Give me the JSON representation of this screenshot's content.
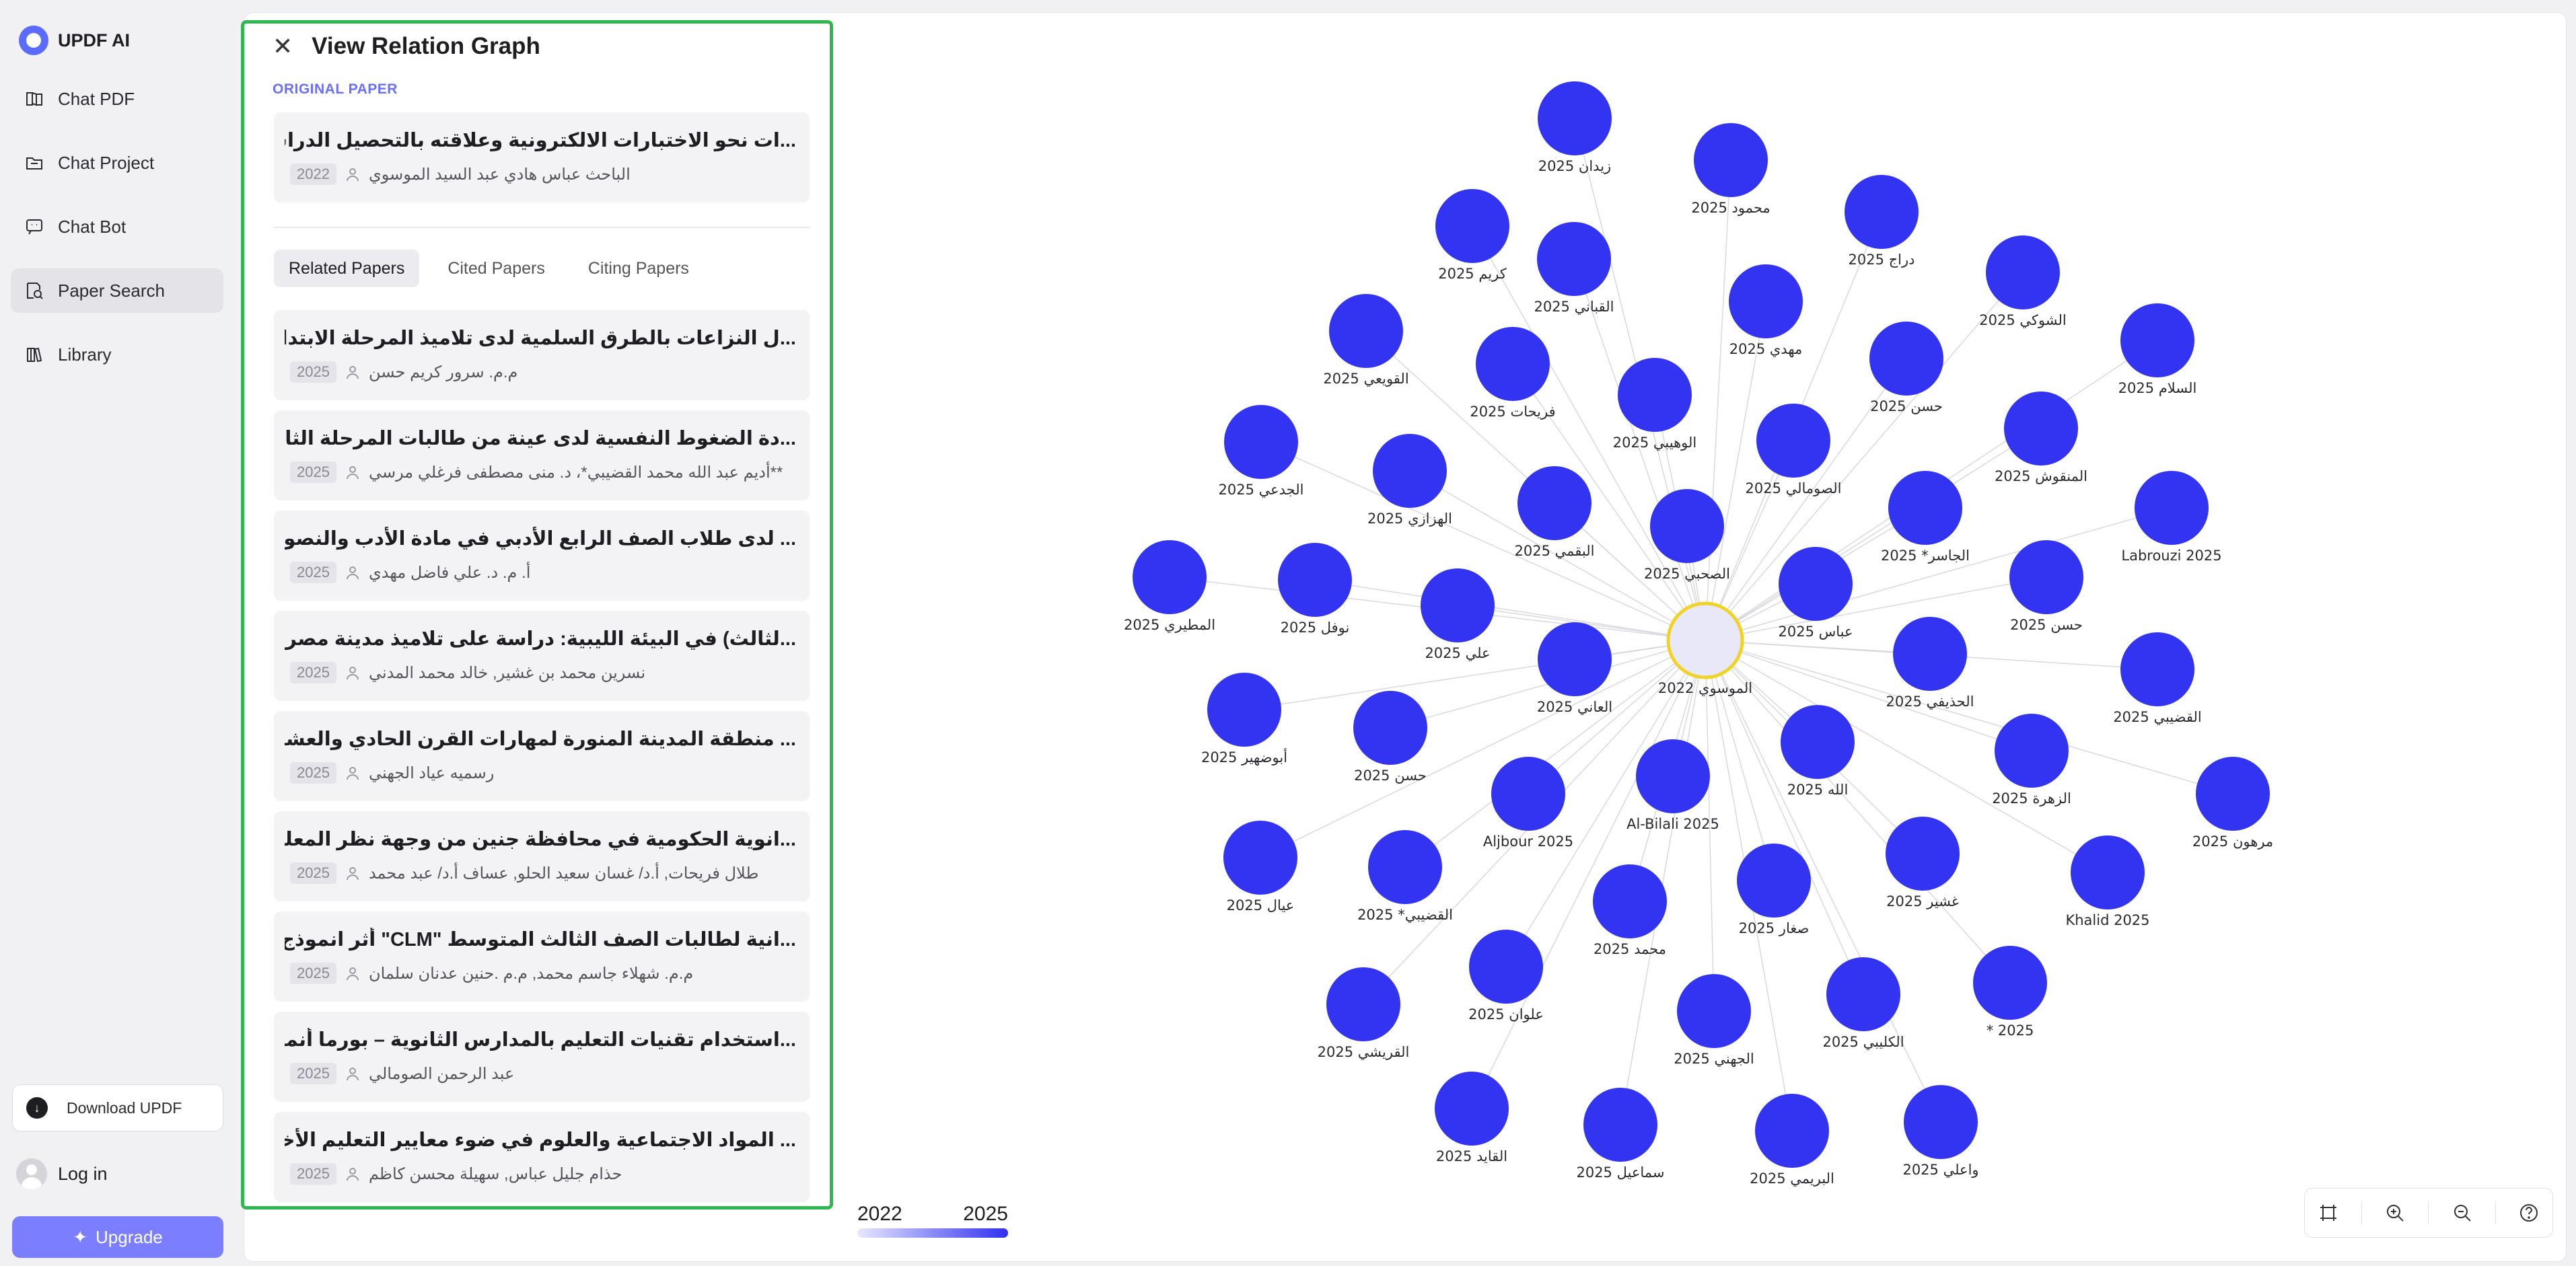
{
  "brand": {
    "name": "UPDF AI"
  },
  "nav": [
    {
      "label": "Chat PDF",
      "icon": "book-icon",
      "active": false
    },
    {
      "label": "Chat Project",
      "icon": "folder-icon",
      "active": false
    },
    {
      "label": "Chat Bot",
      "icon": "bot-icon",
      "active": false
    },
    {
      "label": "Paper Search",
      "icon": "paper-search-icon",
      "active": true
    },
    {
      "label": "Library",
      "icon": "library-icon",
      "active": false
    }
  ],
  "download": {
    "label": "Download UPDF"
  },
  "login": {
    "label": "Log in"
  },
  "upgrade": {
    "label": "Upgrade"
  },
  "panel": {
    "title": "View Relation Graph",
    "original_label": "ORIGINAL PAPER",
    "original": {
      "title": "...ات نحو الاختبارات الالكترونية وعلاقته بالتحصيل الدراسي",
      "year": "2022",
      "authors": "الباحث عباس هادي عبد السيد الموسوي"
    },
    "tabs": [
      {
        "label": "Related Papers",
        "active": true
      },
      {
        "label": "Cited Papers",
        "active": false
      },
      {
        "label": "Citing Papers",
        "active": false
      }
    ],
    "papers": [
      {
        "title": "...ل النزاعات بالطرق السلمية لدى تلاميذ المرحلة الابتدائية",
        "year": "2025",
        "authors": "م.م. سرور كريم حسن"
      },
      {
        "title": "...دة الضغوط النفسية لدى عينة من طالبات المرحلة الثانوية",
        "year": "2025",
        "authors": "أديم عبد الله محمد القضيبي*، د. منى مصطفى فرغلي مرسي**"
      },
      {
        "title": "... لدى طلاب الصف الرابع الأدبي في مادة الأدب والنصوص",
        "year": "2025",
        "authors": "أ. م. د. علي فاضل مهدي"
      },
      {
        "title": "...لثالث) في البيئة الليبية: دراسة على تلاميذ مدينة مصراتة",
        "year": "2025",
        "authors": "نسرين محمد بن غشير, خالد محمد المدني"
      },
      {
        "title": "... منطقة المدينة المنورة لمهارات القرن الحادي والعشرين",
        "year": "2025",
        "authors": "رسميه عياد الجهني"
      },
      {
        "title": "...انوية الحكومية في محافظة جنين من وجهة نظر المعلمين",
        "year": "2025",
        "authors": "طلال فريحات, أ.د/ غسان سعيد الحلو, عساف أ.د/ عبد محمد"
      },
      {
        "title": "...انية لطالبات الصف الثالث المتوسط \"CLM\" أثر انموذج باكر",
        "year": "2025",
        "authors": "م.م. شهلاء جاسم محمد, م.م .حنين عدنان سلمان"
      },
      {
        "title": "...استخدام تقنيات التعليم بالمدارس الثانوية – بورما أنموذجا",
        "year": "2025",
        "authors": "عبد الرحمن الصومالي"
      },
      {
        "title": "... المواد الاجتماعية والعلوم في ضوء معايير التعليم الأخضر",
        "year": "2025",
        "authors": "حذام جليل عباس, سهيلة محسن كاظم"
      }
    ]
  },
  "graph": {
    "center": {
      "label": "الموسوي 2022"
    },
    "nodes": [
      {
        "label": "زيدان 2025"
      },
      {
        "label": "محمود 2025"
      },
      {
        "label": "دراج 2025"
      },
      {
        "label": "كريم 2025"
      },
      {
        "label": "القباني 2025"
      },
      {
        "label": "مهدي 2025"
      },
      {
        "label": "الشوكي 2025"
      },
      {
        "label": "القويعي 2025"
      },
      {
        "label": "فريحات 2025"
      },
      {
        "label": "الوهيبي 2025"
      },
      {
        "label": "حسن 2025"
      },
      {
        "label": "السلام 2025"
      },
      {
        "label": "الجدعي 2025"
      },
      {
        "label": "الهزازي 2025"
      },
      {
        "label": "البقمي 2025"
      },
      {
        "label": "الصومالي 2025"
      },
      {
        "label": "المنقوش 2025"
      },
      {
        "label": "الصحبي 2025"
      },
      {
        "label": "الجاسر* 2025"
      },
      {
        "label": "Labrouzi 2025"
      },
      {
        "label": "المطيري 2025"
      },
      {
        "label": "نوفل 2025"
      },
      {
        "label": "علي 2025"
      },
      {
        "label": "عباس 2025"
      },
      {
        "label": "حسن 2025"
      },
      {
        "label": "العاني 2025"
      },
      {
        "label": "الحذيفي 2025"
      },
      {
        "label": "القضيبي 2025"
      },
      {
        "label": "أبوضهير 2025"
      },
      {
        "label": "حسن 2025"
      },
      {
        "label": "الله 2025"
      },
      {
        "label": "الزهرة 2025"
      },
      {
        "label": "مرهون 2025"
      },
      {
        "label": "Aljbour 2025"
      },
      {
        "label": "Al-Bilali 2025"
      },
      {
        "label": "عيال 2025"
      },
      {
        "label": "القضيبي* 2025"
      },
      {
        "label": "محمد 2025"
      },
      {
        "label": "صغار 2025"
      },
      {
        "label": "غشير 2025"
      },
      {
        "label": "Khalid 2025"
      },
      {
        "label": "علوان 2025"
      },
      {
        "label": "القريشي 2025"
      },
      {
        "label": "الجهني 2025"
      },
      {
        "label": "الكليبي 2025"
      },
      {
        "label": "* 2025"
      },
      {
        "label": "القايد 2025"
      },
      {
        "label": "سماعيل 2025"
      },
      {
        "label": "البريمي 2025"
      },
      {
        "label": "واعلي 2025"
      }
    ]
  },
  "legend": {
    "start": "2022",
    "end": "2025"
  },
  "colors": {
    "node": "#3333f2",
    "center_fill": "#e8e8f8",
    "center_stroke": "#f0d324",
    "accent": "#7b7fff",
    "panel_border": "#2fb84f"
  }
}
